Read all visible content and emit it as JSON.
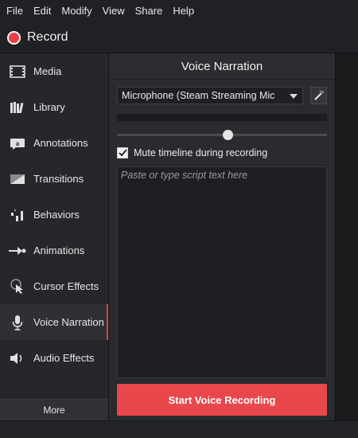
{
  "menu": [
    "File",
    "Edit",
    "Modify",
    "View",
    "Share",
    "Help"
  ],
  "record": {
    "label": "Record",
    "dot_color": "#e84045"
  },
  "sidebar": {
    "items": [
      {
        "label": "Media",
        "icon": "film-icon"
      },
      {
        "label": "Library",
        "icon": "library-icon"
      },
      {
        "label": "Annotations",
        "icon": "annotation-icon"
      },
      {
        "label": "Transitions",
        "icon": "transition-icon"
      },
      {
        "label": "Behaviors",
        "icon": "behaviors-icon"
      },
      {
        "label": "Animations",
        "icon": "animation-icon"
      },
      {
        "label": "Cursor Effects",
        "icon": "cursor-icon"
      },
      {
        "label": "Voice Narration",
        "icon": "microphone-icon",
        "active": true
      },
      {
        "label": "Audio Effects",
        "icon": "speaker-icon"
      }
    ],
    "more_label": "More"
  },
  "panel": {
    "title": "Voice Narration",
    "microphone": "Microphone (Steam Streaming Mic",
    "volume_level": 0.53,
    "mute_checked": true,
    "mute_label": "Mute timeline during recording",
    "script_placeholder": "Paste or type script text here",
    "start_label": "Start Voice Recording",
    "accent_color": "#e8474b"
  }
}
